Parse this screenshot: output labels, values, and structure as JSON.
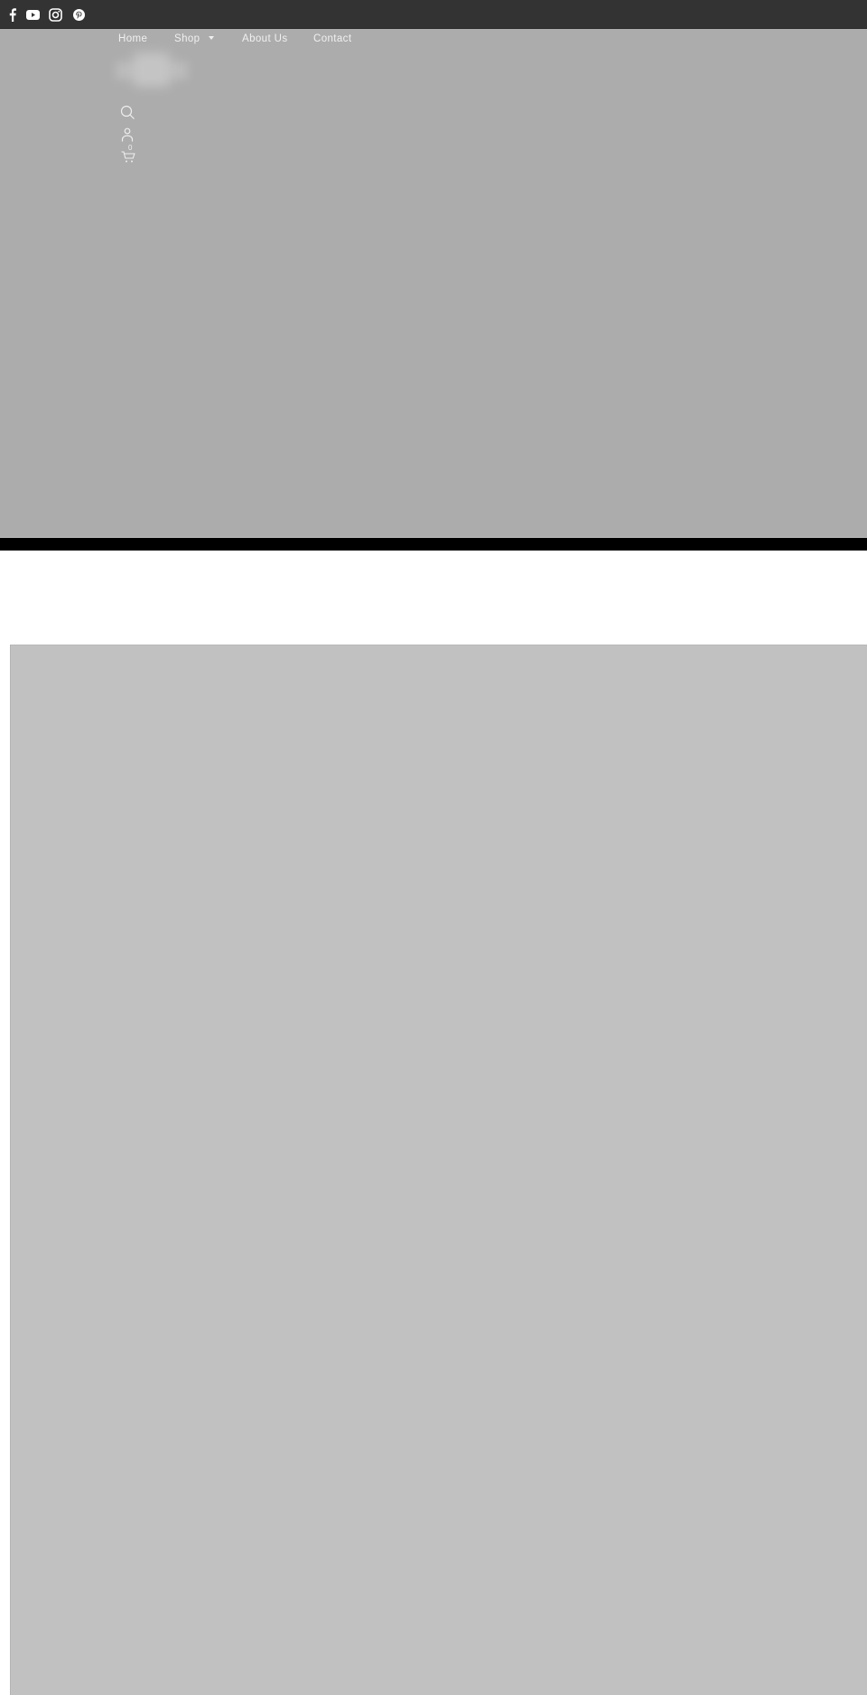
{
  "colors": {
    "topbar": "#333333",
    "hero": "#acacac",
    "band": "#000000",
    "section_image": "#c1c1c1",
    "nav_text": "#f0f0f0"
  },
  "social": [
    {
      "name": "facebook",
      "icon": "facebook-icon"
    },
    {
      "name": "youtube",
      "icon": "youtube-icon"
    },
    {
      "name": "instagram",
      "icon": "instagram-icon"
    },
    {
      "name": "pinterest",
      "icon": "pinterest-icon"
    }
  ],
  "nav": {
    "items": [
      {
        "label": "Home"
      },
      {
        "label": "Shop",
        "has_dropdown": true
      },
      {
        "label": "About Us"
      },
      {
        "label": "Contact"
      }
    ]
  },
  "header": {
    "logo_alt": "Store logo",
    "search_icon": "search-icon",
    "account_icon": "user-icon",
    "cart_icon": "cart-icon",
    "cart_count": "0"
  }
}
